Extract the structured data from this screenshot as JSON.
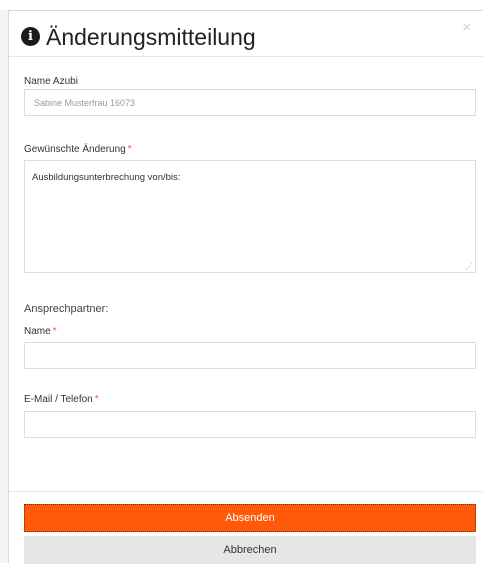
{
  "dialog": {
    "title": "Änderungsmitteilung",
    "close_symbol": "×",
    "info_icon": "info-circle-icon"
  },
  "fields": {
    "name_azubi": {
      "label": "Name Azubi",
      "value": "Sabine Musterfrau 16073"
    },
    "change": {
      "label": "Gewünschte Änderung",
      "required_marker": "*",
      "value": "Ausbildungsunterbrechung von/bis:"
    },
    "contact_heading": "Ansprechpartner:",
    "contact_name": {
      "label": "Name",
      "required_marker": "*",
      "value": ""
    },
    "contact_email_phone": {
      "label": "E-Mail / Telefon",
      "required_marker": "*",
      "value": ""
    }
  },
  "buttons": {
    "submit_label": "Absenden",
    "cancel_label": "Abbrechen"
  },
  "colors": {
    "accent": "#ff5a0a",
    "required": "#f05a28",
    "cancel_bg": "#e6e6e6"
  }
}
